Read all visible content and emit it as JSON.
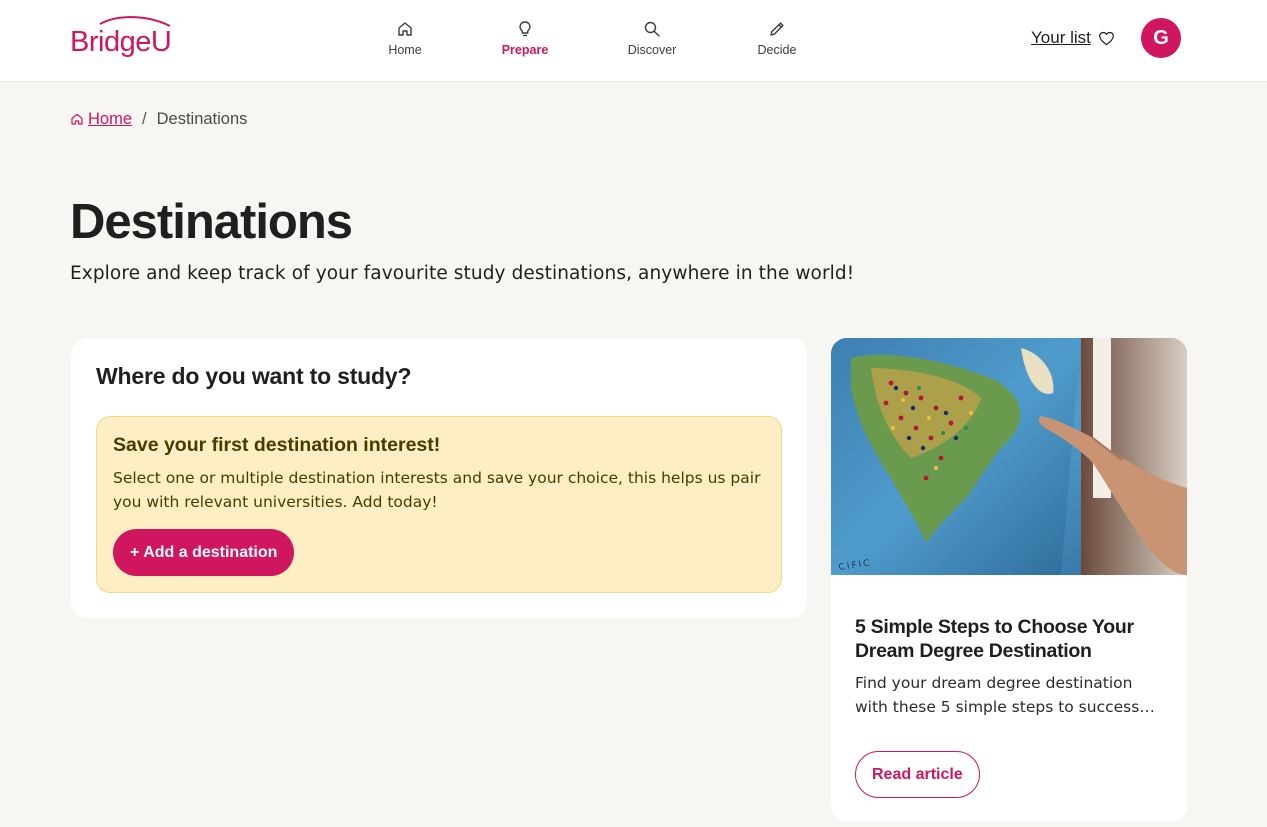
{
  "header": {
    "logo_text": "BridgeU",
    "nav": [
      {
        "label": "Home",
        "icon": "home-icon"
      },
      {
        "label": "Prepare",
        "icon": "lightbulb-icon",
        "active": true
      },
      {
        "label": "Discover",
        "icon": "search-icon"
      },
      {
        "label": "Decide",
        "icon": "pencil-icon"
      }
    ],
    "your_list_label": "Your list",
    "avatar_initial": "G"
  },
  "breadcrumb": {
    "home_label": "Home",
    "separator": "/",
    "current_label": "Destinations"
  },
  "page": {
    "title": "Destinations",
    "subtitle": "Explore and keep track of your favourite study destinations, anywhere in the world!"
  },
  "study_card": {
    "heading": "Where do you want to study?",
    "notice_title": "Save your first destination interest!",
    "notice_body": "Select one or multiple destination interests and save your choice, this helps us pair you with relevant universities. Add today!",
    "add_button_label": "+ Add a destination"
  },
  "article": {
    "title": "5 Simple Steps to Choose Your Dream Degree Destination",
    "excerpt": "Find your dream degree destination with these 5 simple steps to success…",
    "button_label": "Read article"
  },
  "colors": {
    "brand": "#d0165f",
    "background": "#f7f6f3",
    "notice_bg": "#fdefc3",
    "notice_text": "#4a3a00"
  }
}
